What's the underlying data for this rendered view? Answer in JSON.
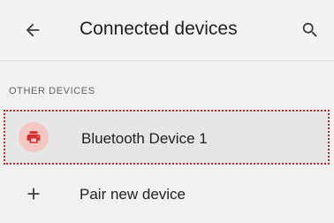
{
  "app_bar": {
    "title": "Connected devices",
    "back_icon": "arrow-back-icon",
    "search_icon": "search-icon"
  },
  "sections": {
    "other_devices": {
      "header": "OTHER DEVICES",
      "devices": [
        {
          "label": "Bluetooth Device 1",
          "icon": "printer-icon",
          "icon_color": "#d32f2f",
          "icon_background": "#f4c7c3",
          "highlighted": true,
          "highlight_color": "#c62828"
        }
      ]
    }
  },
  "pair_new_device": {
    "label": "Pair new device",
    "icon": "plus-icon"
  }
}
